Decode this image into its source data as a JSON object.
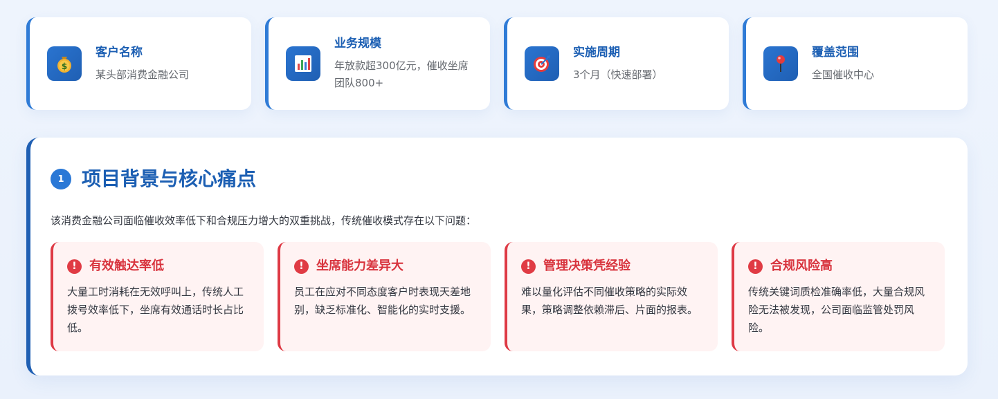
{
  "info_cards": [
    {
      "icon": "money-bag-icon",
      "title": "客户名称",
      "value": "某头部消费金融公司"
    },
    {
      "icon": "bar-chart-icon",
      "title": "业务规模",
      "value": "年放款超300亿元，催收坐席团队800+"
    },
    {
      "icon": "target-icon",
      "title": "实施周期",
      "value": "3个月（快速部署）"
    },
    {
      "icon": "pin-icon",
      "title": "覆盖范围",
      "value": "全国催收中心"
    }
  ],
  "section": {
    "number": "1",
    "title": "项目背景与核心痛点",
    "intro": "该消费金融公司面临催收效率低下和合规压力增大的双重挑战，传统催收模式存在以下问题："
  },
  "pain_points": [
    {
      "icon": "alert-icon",
      "title": "有效触达率低",
      "desc": "大量工时消耗在无效呼叫上，传统人工拨号效率低下，坐席有效通话时长占比低。"
    },
    {
      "icon": "alert-icon",
      "title": "坐席能力差异大",
      "desc": "员工在应对不同态度客户时表现天差地别，缺乏标准化、智能化的实时支援。"
    },
    {
      "icon": "alert-icon",
      "title": "管理决策凭经验",
      "desc": "难以量化评估不同催收策略的实际效果，策略调整依赖滞后、片面的报表。"
    },
    {
      "icon": "alert-icon",
      "title": "合规风险高",
      "desc": "传统关键词质检准确率低，大量合规风险无法被发现，公司面临监管处罚风险。"
    }
  ],
  "colors": {
    "primary": "#1c5fb3",
    "accent": "#2f7bd6",
    "danger": "#de3a45",
    "danger_bg": "#fff3f3"
  }
}
